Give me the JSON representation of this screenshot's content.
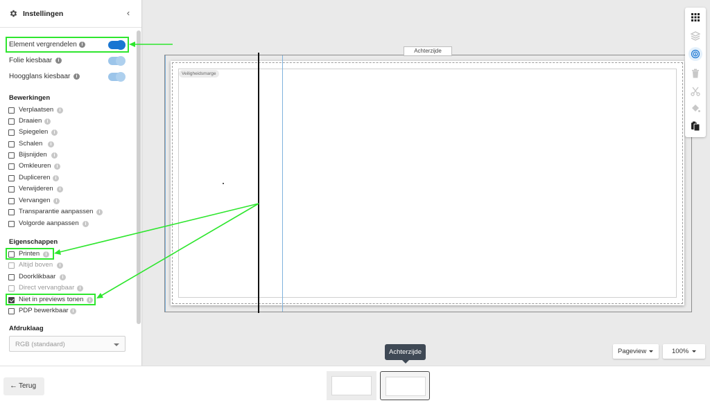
{
  "sidebar": {
    "title": "Instellingen",
    "toggles": [
      {
        "label": "Element vergrendelen",
        "on": true
      },
      {
        "label": "Folie kiesbaar",
        "on": false
      },
      {
        "label": "Hoogglans kiesbaar",
        "on": false
      }
    ],
    "sections": {
      "bewerkingen": "Bewerkingen",
      "eigenschappen": "Eigenschappen",
      "afdruklaag": "Afdruklaag"
    },
    "bewerkingen": [
      {
        "label": "Verplaatsen",
        "checked": false
      },
      {
        "label": "Draaien",
        "checked": false
      },
      {
        "label": "Spiegelen",
        "checked": false
      },
      {
        "label": "Schalen",
        "checked": false
      },
      {
        "label": "Bijsnijden",
        "checked": false
      },
      {
        "label": "Omkleuren",
        "checked": false
      },
      {
        "label": "Dupliceren",
        "checked": false
      },
      {
        "label": "Verwijderen",
        "checked": false
      },
      {
        "label": "Vervangen",
        "checked": false
      },
      {
        "label": "Transparantie aanpassen",
        "checked": false
      },
      {
        "label": "Volgorde aanpassen",
        "checked": false
      }
    ],
    "eigenschappen": [
      {
        "label": "Printen",
        "checked": false,
        "disabled": false
      },
      {
        "label": "Altijd boven",
        "checked": false,
        "disabled": true
      },
      {
        "label": "Doorklikbaar",
        "checked": false,
        "disabled": false
      },
      {
        "label": "Direct vervangbaar",
        "checked": false,
        "disabled": true
      },
      {
        "label": "Niet in previews tonen",
        "checked": true,
        "disabled": false
      },
      {
        "label": "PDP bewerkbaar",
        "checked": false,
        "disabled": false
      }
    ],
    "afdruklaag_value": "RGB (standaard)"
  },
  "canvas": {
    "side_label": "Achterzijde",
    "safety_margin_label": "Veiligheidsmarge"
  },
  "controls": {
    "view_mode": "Pageview",
    "zoom": "100%"
  },
  "tooltip": "Achterzijde",
  "footer": {
    "back_label": "Terug",
    "back_arrow": "←"
  },
  "info_glyph": "i",
  "colors": {
    "toggle_on": "#1976d2",
    "toggle_off": "#9cc5ea",
    "annotation": "#2ee62e",
    "tooltip_bg": "#3f4955"
  }
}
